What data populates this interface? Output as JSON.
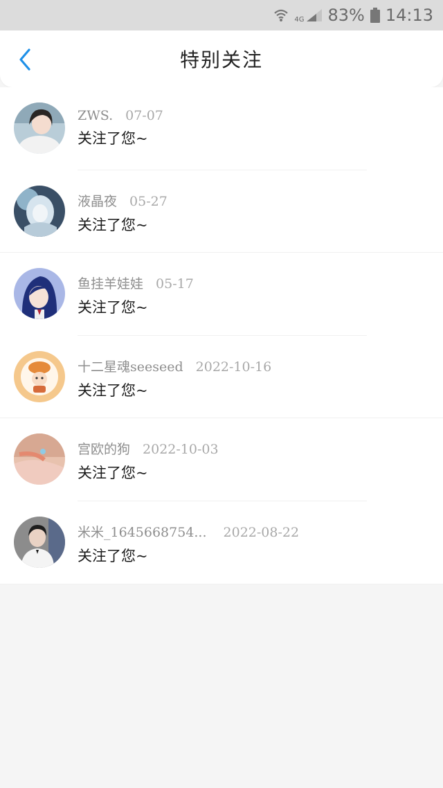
{
  "status_bar": {
    "network": "4G",
    "battery_percent": "83%",
    "time": "14:13"
  },
  "header": {
    "title": "特别关注",
    "back_icon": "chevron-left-icon",
    "accent_color": "#1e90e8"
  },
  "list": {
    "items": [
      {
        "name": "ZWS.",
        "date": "07-07",
        "message": "关注了您~"
      },
      {
        "name": "液晶夜",
        "date": "05-27",
        "message": "关注了您~"
      },
      {
        "name": "鱼挂羊娃娃",
        "date": "05-17",
        "message": "关注了您~"
      },
      {
        "name": "十二星魂seeseed",
        "date": "2022-10-16",
        "message": "关注了您~"
      },
      {
        "name": "宫欧的狗",
        "date": "2022-10-03",
        "message": "关注了您~"
      },
      {
        "name": "米米_1645668754...",
        "date": "2022-08-22",
        "message": "关注了您~"
      }
    ]
  }
}
